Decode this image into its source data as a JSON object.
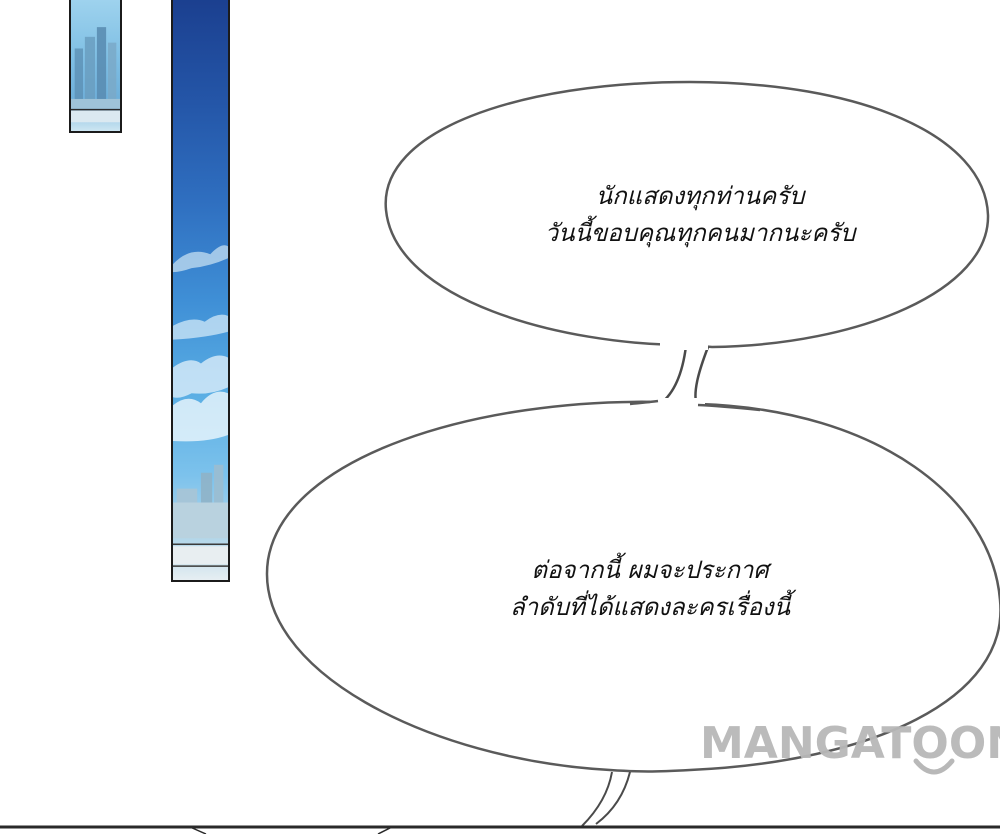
{
  "bubbles": {
    "top": {
      "line1": "นักแสดงทุกท่านครับ",
      "line2": "วันนี้ขอบคุณทุกคนมากนะครับ"
    },
    "bottom": {
      "line1": "ต่อจากนี้ ผมจะประกาศ",
      "line2": "ลำดับที่ได้แสดงละครเรื่องนี้"
    }
  },
  "watermark": {
    "text": "MANGATOON"
  },
  "colors": {
    "bubble_stroke": "#5a5a5a",
    "bubble_fill": "#ffffff",
    "panel_border": "#1b1b1b",
    "sky_dark": "#1b3f8f",
    "sky_light": "#7cc2ec",
    "watermark": "#b8b8b8"
  }
}
